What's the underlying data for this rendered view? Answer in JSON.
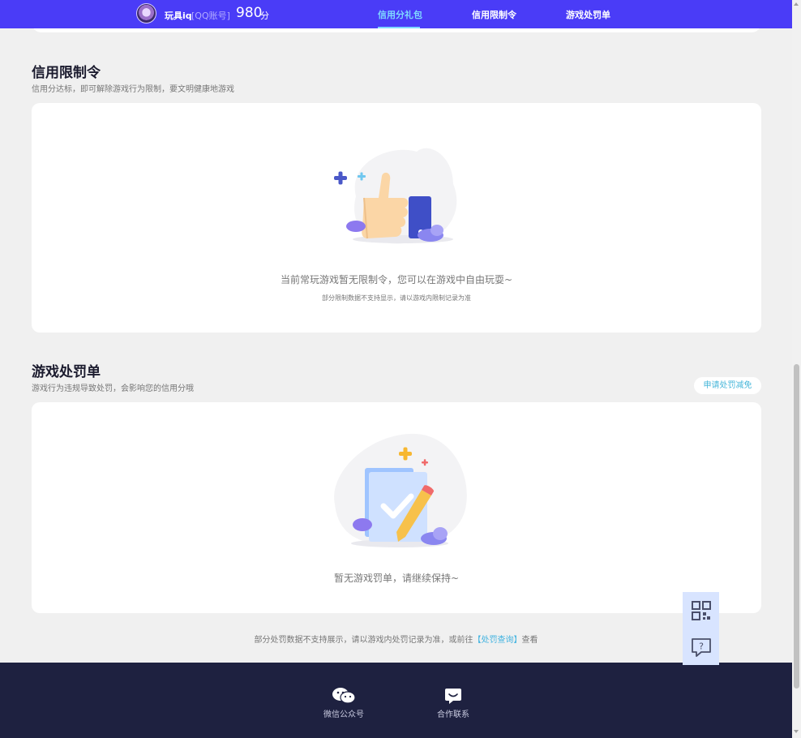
{
  "header": {
    "username": "玩具iq",
    "account_type": "[QQ账号]",
    "score": "980",
    "score_unit": "分",
    "nav": [
      "信用分礼包",
      "信用限制令",
      "游戏处罚单"
    ],
    "active_nav": "信用分礼包"
  },
  "restriction": {
    "title": "信用限制令",
    "subtitle": "信用分达标，即可解除游戏行为限制，要文明健康地游戏",
    "empty_message": "当前常玩游戏暂无限制令，您可以在游戏中自由玩耍~",
    "empty_note": "部分限制数据不支持显示，请以游戏内限制记录为准"
  },
  "penalty": {
    "title": "游戏处罚单",
    "subtitle": "游戏行为违规导致处罚，会影响您的信用分哦",
    "appeal_button": "申请处罚减免",
    "empty_message": "暂无游戏罚单，请继续保持~",
    "footnote_before": "部分处罚数据不支持展示，请以游戏内处罚记录为准，或前往",
    "footnote_link": "【处罚查询】",
    "footnote_after": "查看"
  },
  "footer": {
    "wechat_label": "微信公众号",
    "contact_label": "合作联系"
  },
  "colors": {
    "header_bg": "#4a3cf7",
    "nav_active": "#7fd8ff",
    "link": "#3fb2e0",
    "footer_bg": "#1e2140",
    "float_bg": "#d8e4ff"
  },
  "icons": [
    "avatar",
    "thumbs-up-illustration",
    "checklist-pencil-illustration",
    "wechat-icon",
    "chat-icon",
    "qr-code-icon",
    "help-chat-icon"
  ]
}
